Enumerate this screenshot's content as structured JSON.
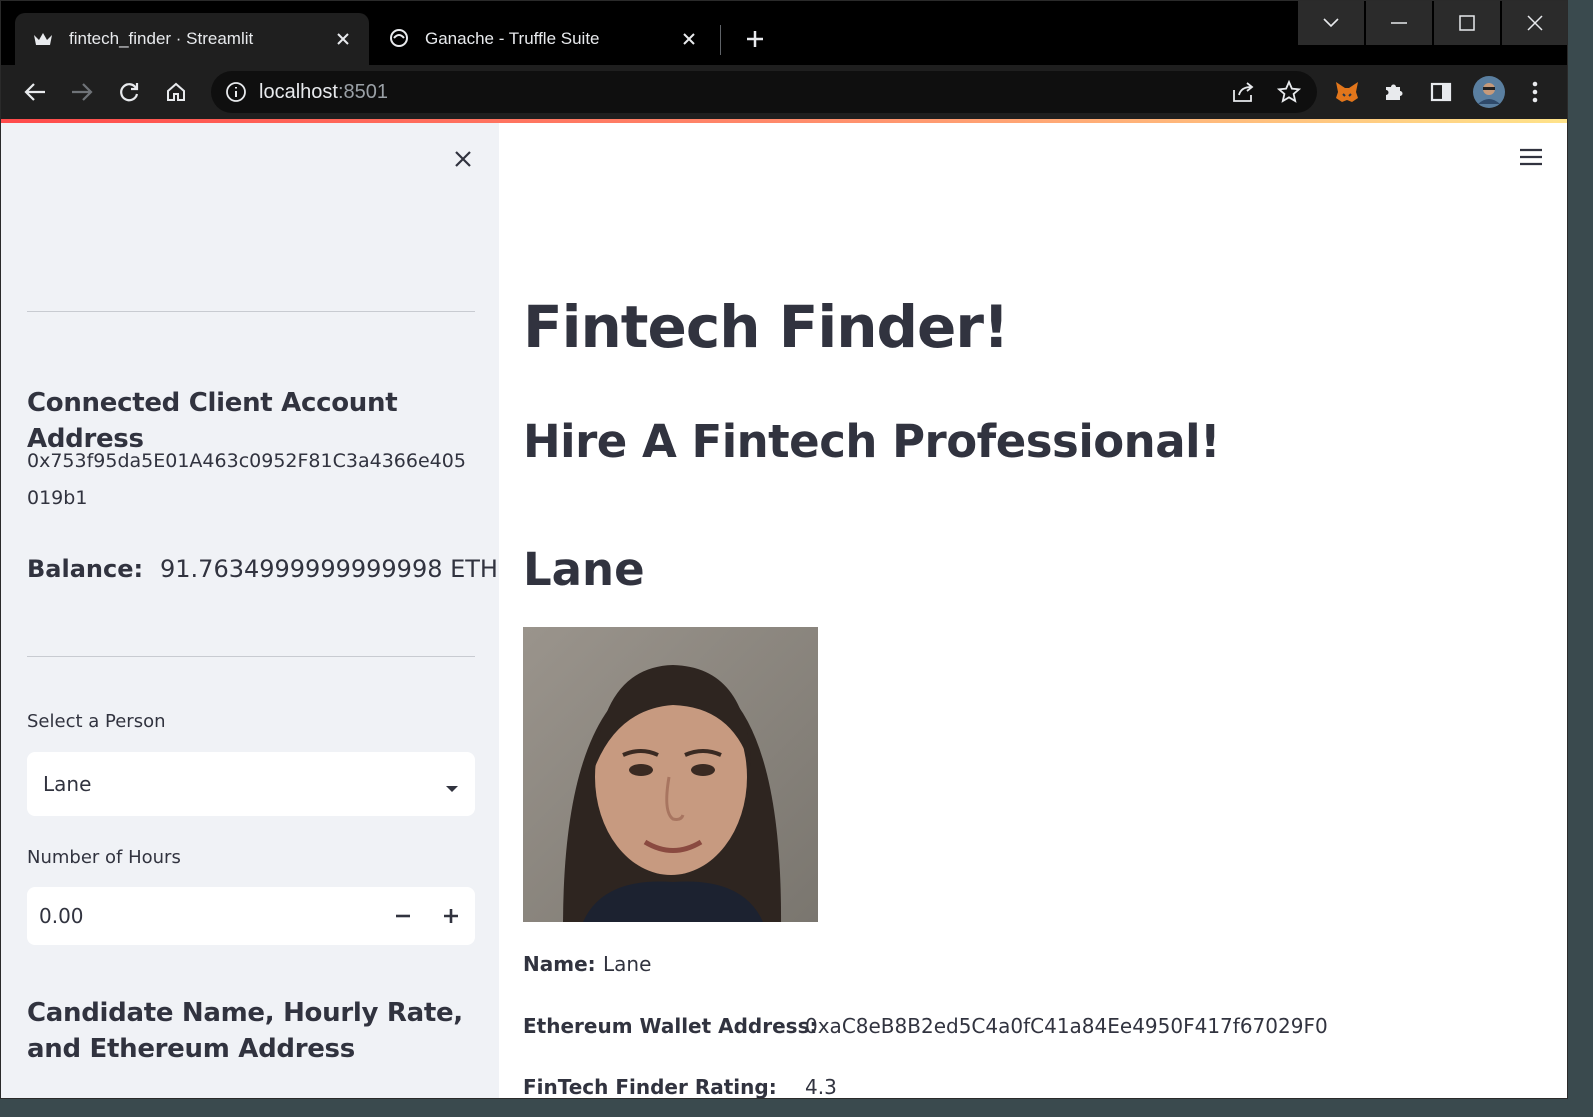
{
  "browser": {
    "tabs": [
      {
        "title": "fintech_finder · Streamlit",
        "active": true
      },
      {
        "title": "Ganache - Truffle Suite",
        "active": false
      }
    ],
    "url_host": "localhost",
    "url_port": ":8501"
  },
  "sidebar": {
    "account_heading": "Connected Client Account Address",
    "account_address": "0x753f95da5E01A463c0952F81C3a4366e405019b1",
    "balance_label": "Balance:",
    "balance_value": "91.7634999999999998 ETH",
    "select_label": "Select a Person",
    "select_value": "Lane",
    "hours_label": "Number of Hours",
    "hours_value": "0.00",
    "candidate_heading": "Candidate Name, Hourly Rate, and Ethereum Address"
  },
  "main": {
    "title": "Fintech Finder!",
    "subtitle": "Hire A Fintech Professional!",
    "candidate_name_heading": "Lane",
    "name_label": "Name:",
    "name_value": "Lane",
    "wallet_label": "Ethereum Wallet Address:",
    "wallet_value": "0xaC8eB8B2ed5C4a0fC41a84Ee4950F417f67029F0",
    "rating_label": "FinTech Finder Rating:",
    "rating_value": "4.3"
  },
  "colors": {
    "sidebar_bg": "#f0f2f6",
    "text": "#31333f",
    "accent": "#ff4b4b"
  }
}
